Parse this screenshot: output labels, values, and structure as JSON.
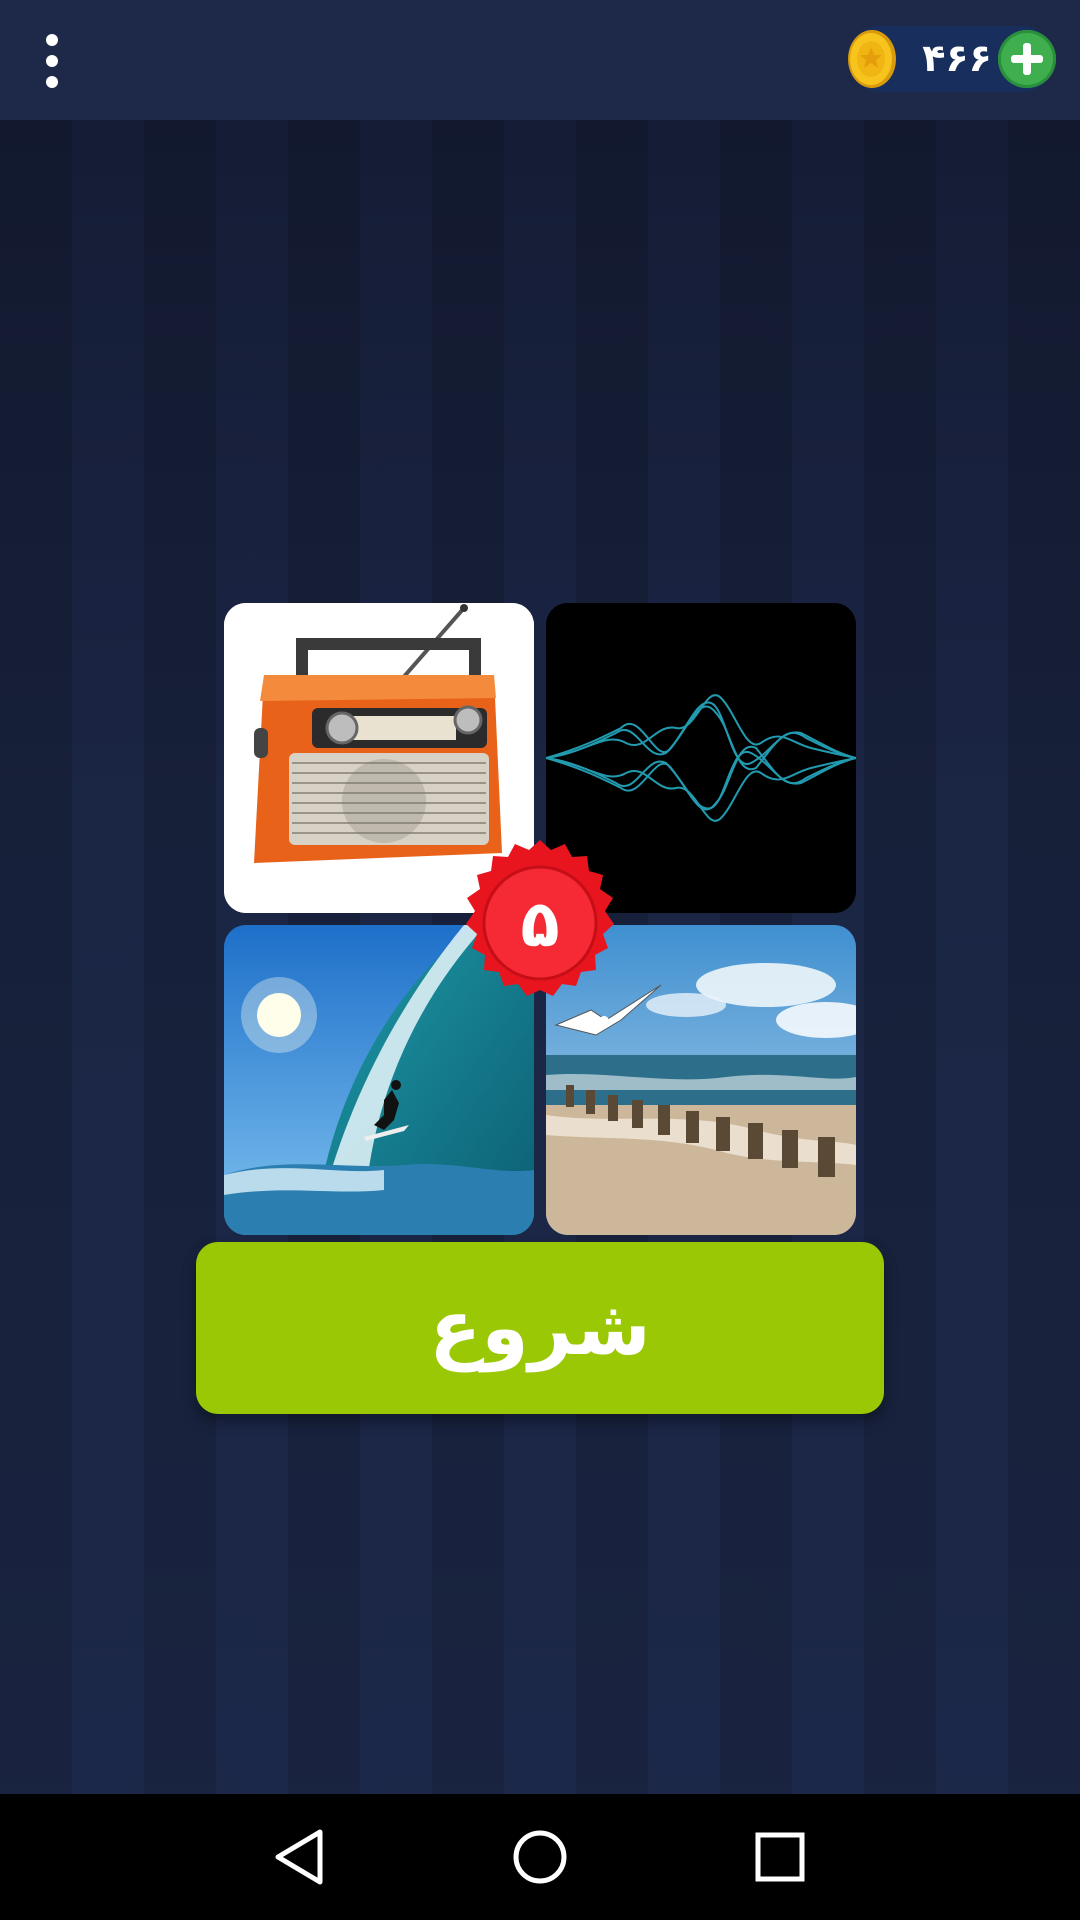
{
  "header": {
    "coins": "۴۶۶",
    "menu_icon": "more-vertical-icon",
    "coin_icon": "gold-coin-icon",
    "add_icon": "plus-icon"
  },
  "puzzle": {
    "tiles": [
      "radio",
      "sound-wave",
      "surfing-wave",
      "sea-beach"
    ],
    "level": "۵"
  },
  "start_button": {
    "label": "شروع"
  },
  "colors": {
    "start_button": "#9bc805",
    "badge": "#e8151f",
    "add_button": "#3fae4f",
    "coin": "#f5c21a"
  },
  "navigation": {
    "back_icon": "back-triangle-icon",
    "home_icon": "home-circle-icon",
    "recents_icon": "recents-square-icon"
  }
}
